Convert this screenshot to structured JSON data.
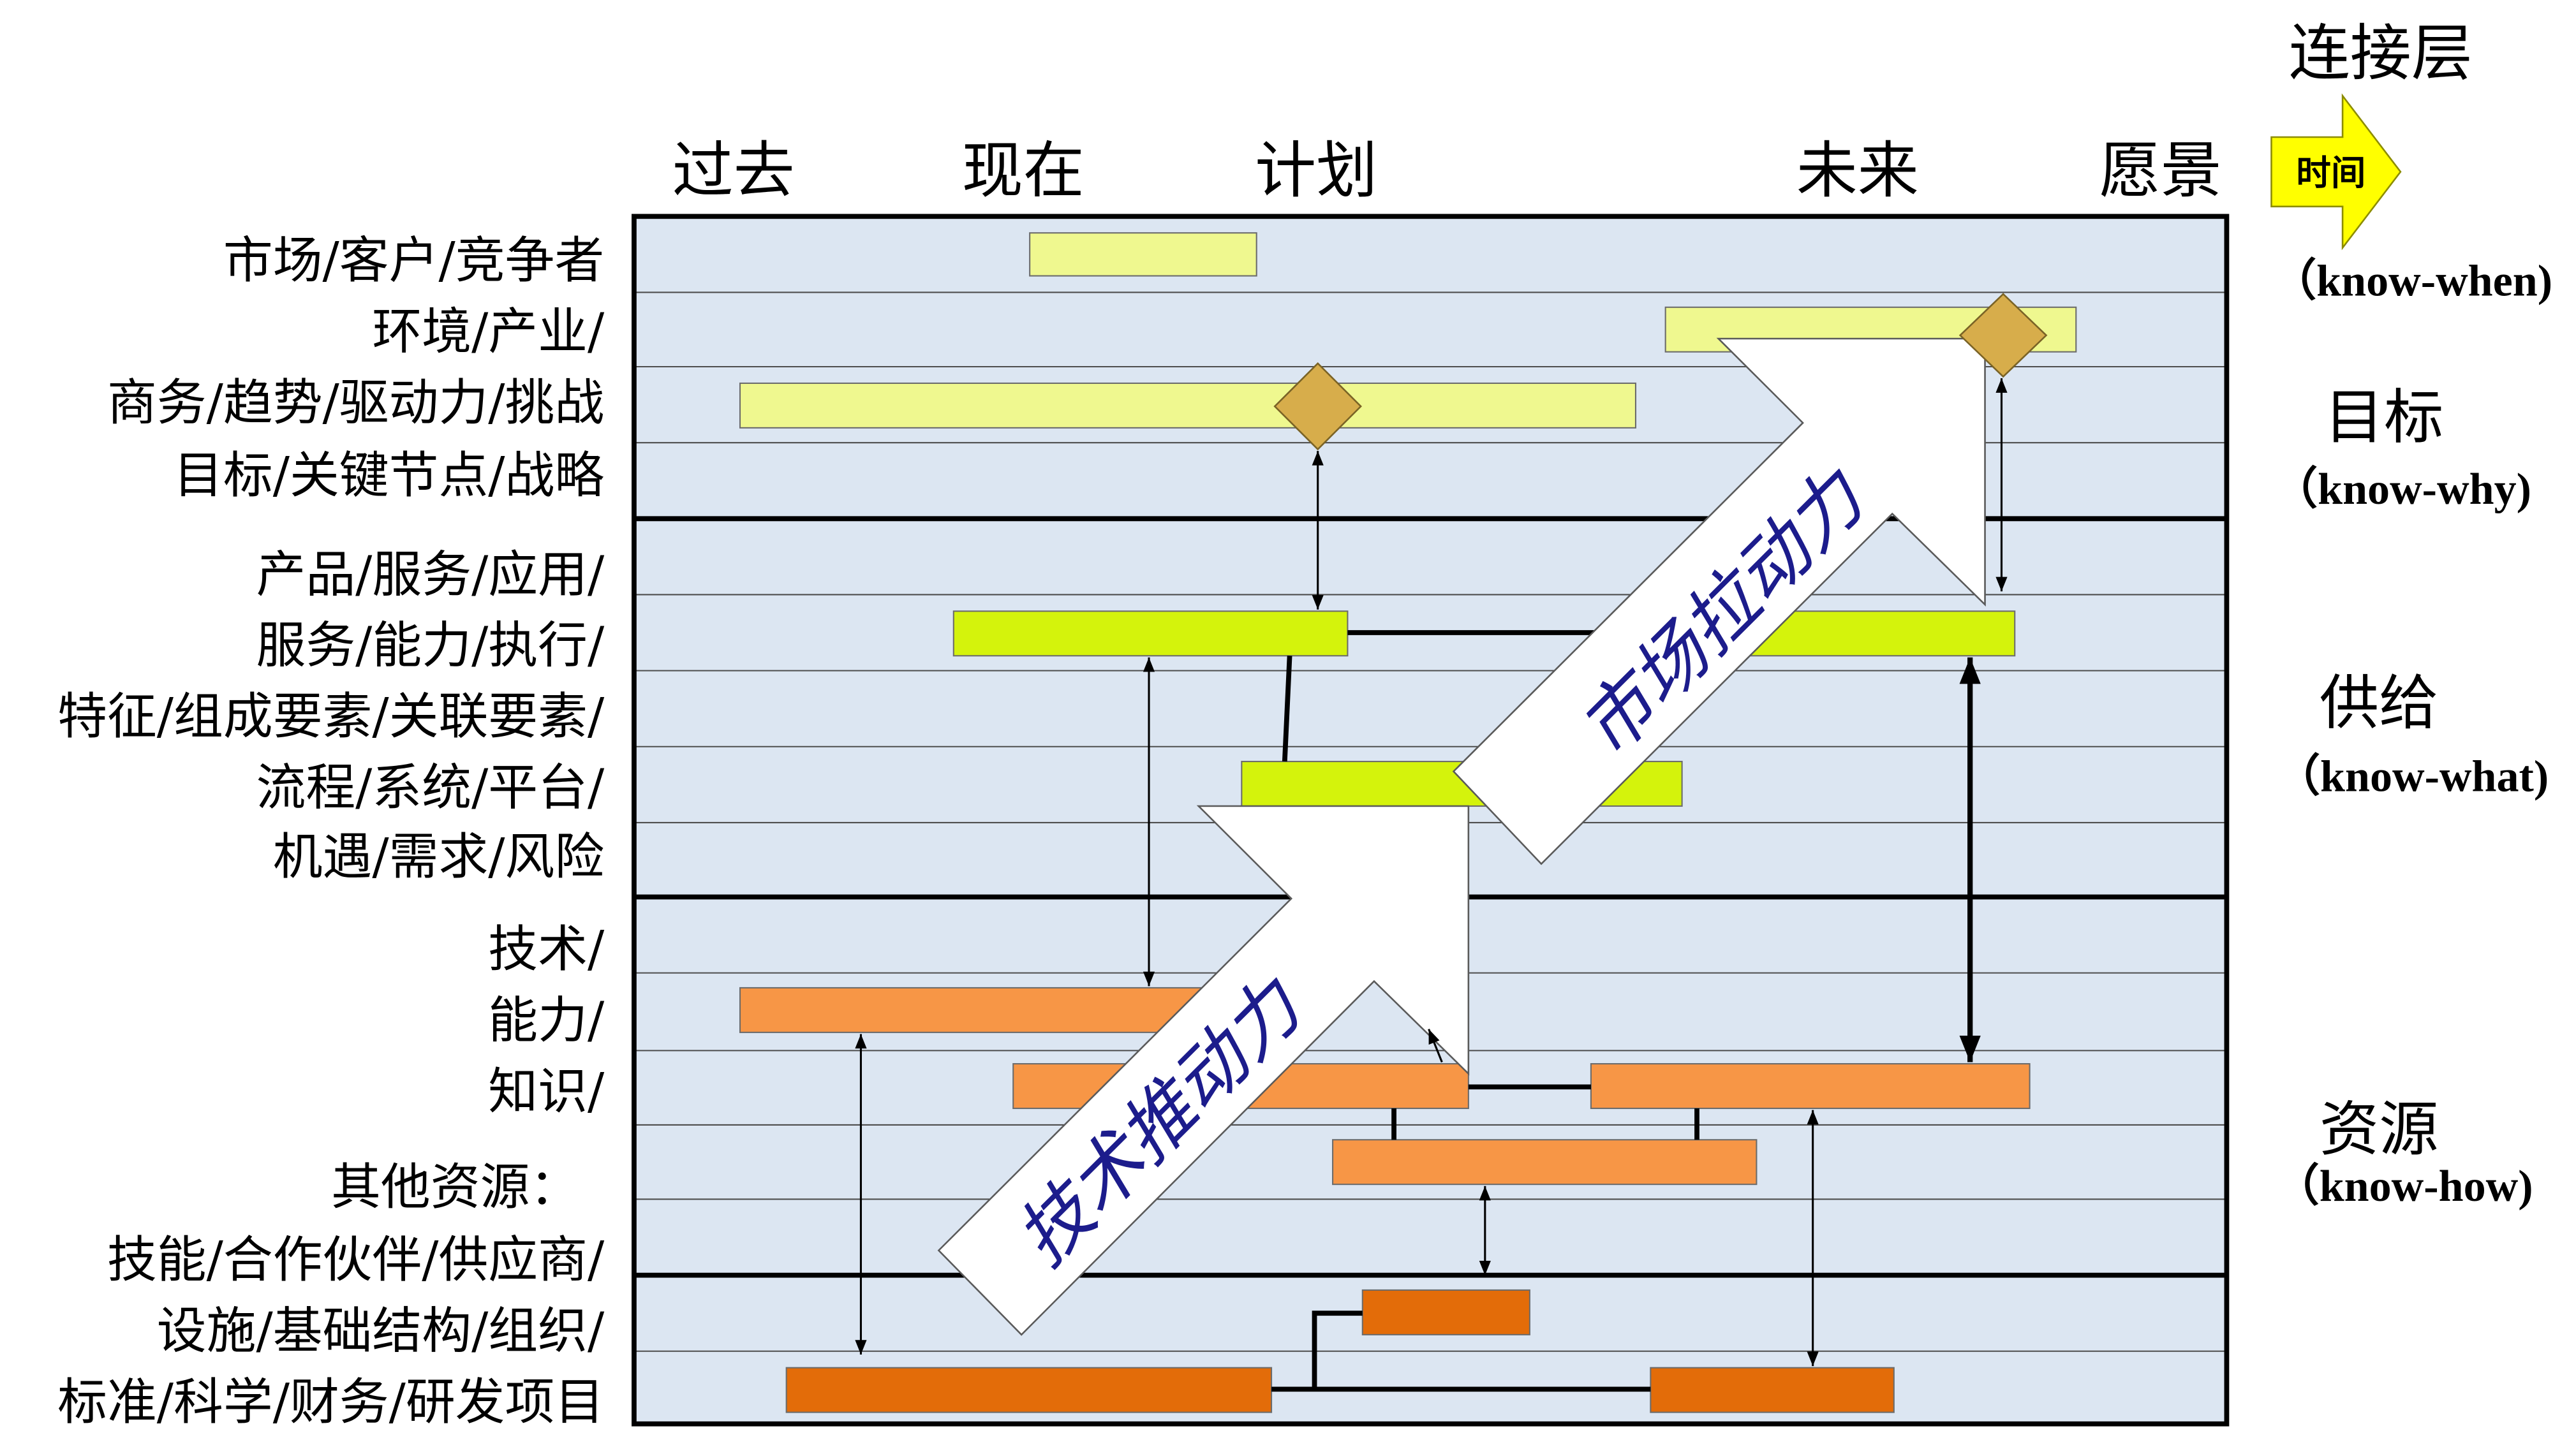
{
  "header": {
    "connection_layer": "连接层",
    "time_arrow": "时间",
    "timeline": {
      "past": "过去",
      "present": "现在",
      "plan": "计划",
      "future": "未来",
      "vision": "愿景"
    }
  },
  "left_labels": [
    "市场/客户/竞争者",
    "环境/产业/",
    "商务/趋势/驱动力/挑战",
    "目标/关键节点/战略",
    "产品/服务/应用/",
    "服务/能力/执行/",
    "特征/组成要素/关联要素/",
    "流程/系统/平台/",
    "机遇/需求/风险",
    "技术/",
    "能力/",
    "知识/",
    "其他资源：",
    "技能/合作伙伴/供应商/",
    "设施/基础结构/组织/",
    "标准/科学/财务/研发项目"
  ],
  "right_labels": {
    "know_when": "（know-when)",
    "goal": "目标",
    "know_why": "（know-why)",
    "supply": "供给",
    "know_what": "（know-what)",
    "resources": "资源",
    "know_how": "（know-how)"
  },
  "forces": {
    "technology_push": "技术推动力",
    "market_pull": "市场拉动力"
  },
  "colors": {
    "chart_background": "#dce6f2",
    "market_bar": "#eff88f",
    "milestone_diamond": "#d7ad4b",
    "supply_bar": "#d4f30c",
    "technology_bar": "#f79646",
    "resource_bar": "#e36c09",
    "time_arrow": "#ffff00",
    "force_arrow": "#ffffff",
    "force_text": "#1c1c8c"
  }
}
